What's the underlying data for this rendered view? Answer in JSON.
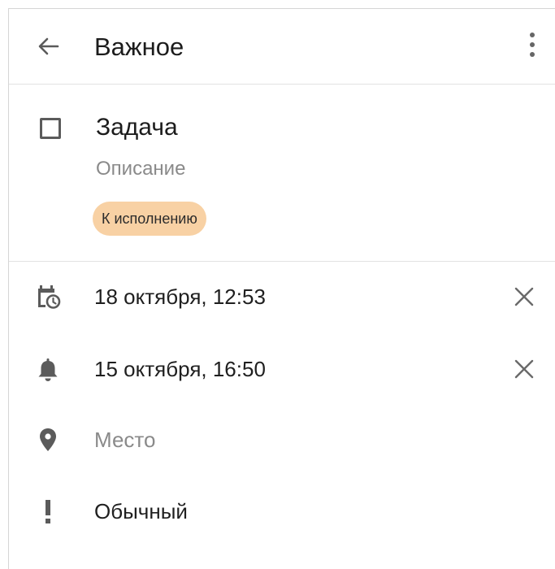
{
  "header": {
    "title": "Важное",
    "back_icon": "arrow-back-icon",
    "menu_icon": "more-vertical-icon"
  },
  "task": {
    "title": "Задача",
    "description": "Описание",
    "checked": false,
    "status": "К исполнению",
    "status_color": "#f8d1a4"
  },
  "details": {
    "deadline": {
      "icon": "calendar-clock-icon",
      "value": "18 октября, 12:53"
    },
    "reminder": {
      "icon": "bell-icon",
      "value": "15 октября, 16:50"
    },
    "location": {
      "icon": "location-pin-icon",
      "placeholder": "Место"
    },
    "priority": {
      "icon": "exclamation-icon",
      "value": "Обычный"
    }
  },
  "colors": {
    "text_primary": "#1c1c1c",
    "text_secondary": "#8a8a8a",
    "icon": "#5b5b5b",
    "divider": "#e2e2e2"
  }
}
